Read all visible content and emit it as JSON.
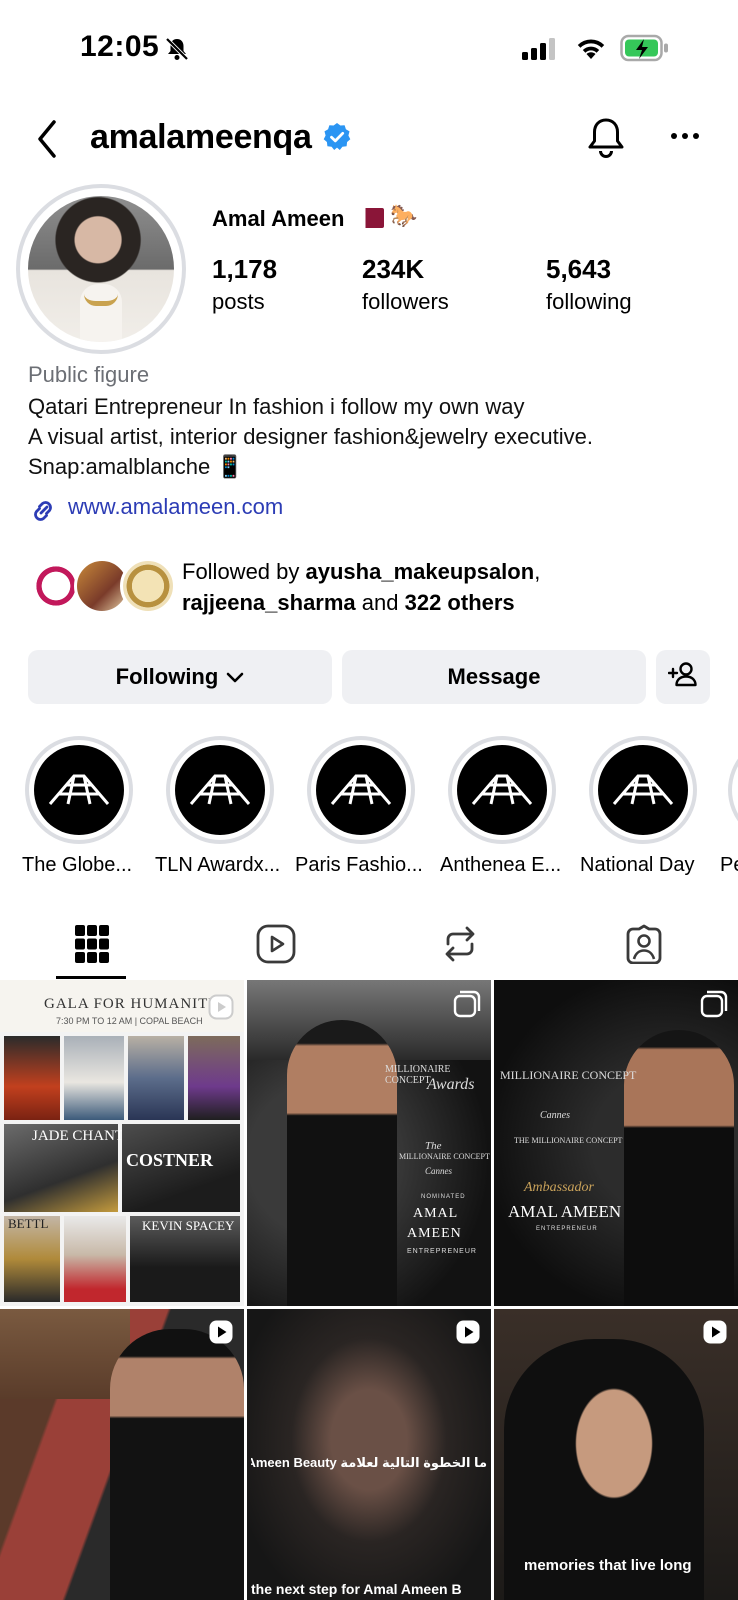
{
  "status_bar": {
    "time": "12:05"
  },
  "header": {
    "username": "amalameenqa"
  },
  "profile": {
    "display_name": "Amal Ameen",
    "stats": [
      {
        "value": "1,178",
        "label": "posts"
      },
      {
        "value": "234K",
        "label": "followers"
      },
      {
        "value": "5,643",
        "label": "following"
      }
    ],
    "category": "Public figure",
    "bio": [
      "Qatari Entrepreneur In fashion i follow my own way",
      "A visual artist, interior designer fashion&jewelry executive.",
      "Snap:amalblanche 📱"
    ],
    "link": "www.amalameen.com",
    "followed_by_prefix": "Followed by ",
    "followed_by_user1": "ayusha_makeupsalon",
    "followed_by_comma": ",",
    "followed_by_user2": "rajjeena_sharma",
    "followed_by_and": " and ",
    "followed_by_others": "322 others"
  },
  "actions": {
    "following": "Following",
    "message": "Message"
  },
  "highlights": [
    {
      "label": "The Globe..."
    },
    {
      "label": "TLN Awardx..."
    },
    {
      "label": "Paris Fashio..."
    },
    {
      "label": "Anthenea E..."
    },
    {
      "label": "National Day"
    },
    {
      "label": "Pe"
    }
  ],
  "tabs": [
    "grid",
    "reels",
    "reposts",
    "tagged"
  ],
  "posts": [
    {
      "caption_top": "GALA FOR HUMANITY",
      "caption_sub": "7:30 PM TO 12 AM | COPAL BEACH",
      "labels": [
        "JADE CHANTE",
        "COSTNER",
        "KEVIN SPACEY",
        "BETTL"
      ]
    },
    {
      "lines": [
        "MILLIONAIRE CONCEPT",
        "Awards",
        "The",
        "MILLIONAIRE CONCEPT",
        "Cannes",
        "NOMINATED",
        "AMAL",
        "AMEEN",
        "ENTREPRENEUR"
      ]
    },
    {
      "lines": [
        "MILLIONAIRE CONCEPT",
        "Cannes",
        "THE MILLIONAIRE CONCEPT",
        "Ambassador",
        "AMAL AMEEN",
        "ENTREPRENEUR"
      ]
    },
    {
      "caption": ""
    },
    {
      "caption_ar": "ما الخطوة التالية لعلامة Amal Ameen Beauty؟",
      "caption_en": "the next step for Amal Ameen B"
    },
    {
      "caption": "memories that live long"
    }
  ],
  "colors": {
    "link": "#2c3cb5",
    "verified": "#2b95f3",
    "button_bg": "#eff0f3",
    "muted": "#6c6f75",
    "battery": "#35c759"
  }
}
